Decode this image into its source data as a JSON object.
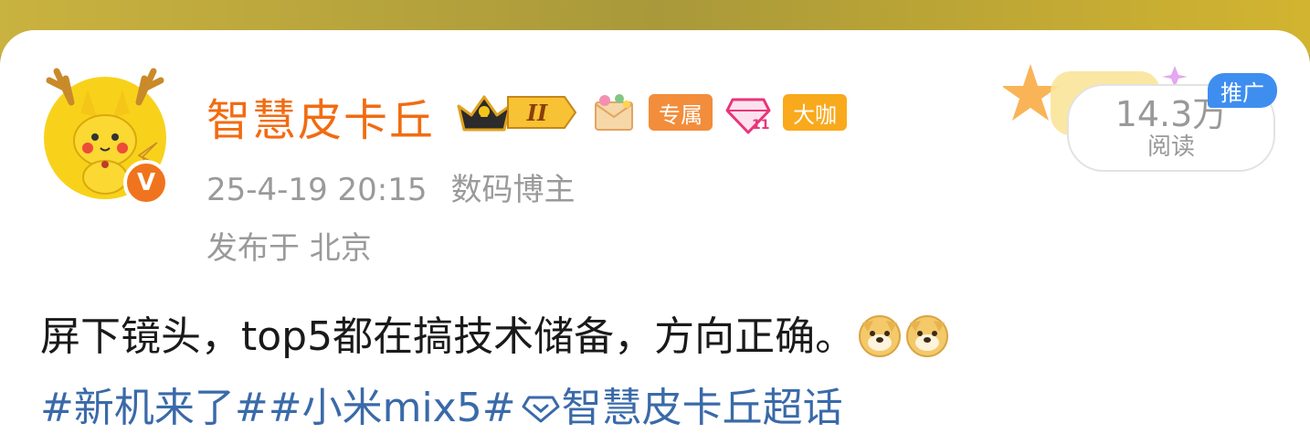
{
  "user": {
    "name": "智慧皮卡丘",
    "level_badge": "II",
    "exclusive_tag": "专属",
    "daka_tag": "大咖",
    "verified_mark": "V"
  },
  "post": {
    "time": "25-4-19 20:15",
    "role": "数码博主",
    "location": "发布于 北京",
    "text": "屏下镜头，top5都在搞技术储备，方向正确。",
    "emoji": [
      "doge-emoji",
      "doge-emoji"
    ],
    "topics": [
      "#新机来了#",
      "#小米mix5#"
    ],
    "super_topic": "智慧皮卡丘超话"
  },
  "stats": {
    "read_count": "14.3万",
    "read_label": "阅读",
    "promo_label": "推广"
  },
  "colors": {
    "username": "#f26b11",
    "topic_link": "#3a6aa8",
    "promo_blue": "#3e8ef0",
    "meta_gray": "#9a9a9a"
  }
}
